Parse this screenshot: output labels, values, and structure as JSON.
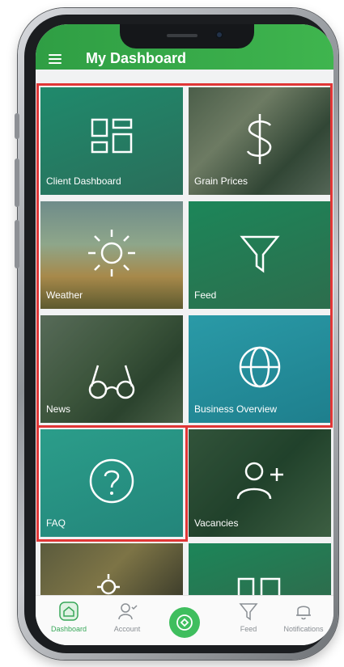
{
  "app": {
    "title": "My Dashboard"
  },
  "tiles": [
    {
      "label": "Client Dashboard",
      "icon": "dashboard-grid-icon"
    },
    {
      "label": "Grain Prices",
      "icon": "dollar-icon"
    },
    {
      "label": "Weather",
      "icon": "sun-icon"
    },
    {
      "label": "Feed",
      "icon": "filter-icon"
    },
    {
      "label": "News",
      "icon": "glasses-icon"
    },
    {
      "label": "Business Overview",
      "icon": "globe-icon"
    },
    {
      "label": "FAQ",
      "icon": "question-icon"
    },
    {
      "label": "Vacancies",
      "icon": "add-user-icon"
    }
  ],
  "bottom_nav": [
    {
      "label": "Dashboard",
      "icon": "home-icon",
      "active": true
    },
    {
      "label": "Account",
      "icon": "account-icon",
      "active": false
    },
    {
      "label": "",
      "icon": "center-action-icon",
      "active": false
    },
    {
      "label": "Feed",
      "icon": "filter-icon",
      "active": false
    },
    {
      "label": "Notifications",
      "icon": "bell-icon",
      "active": false
    }
  ],
  "colors": {
    "accent": "#3fbe5e",
    "highlight": "#e03636",
    "appbar": "#3fb54e"
  }
}
